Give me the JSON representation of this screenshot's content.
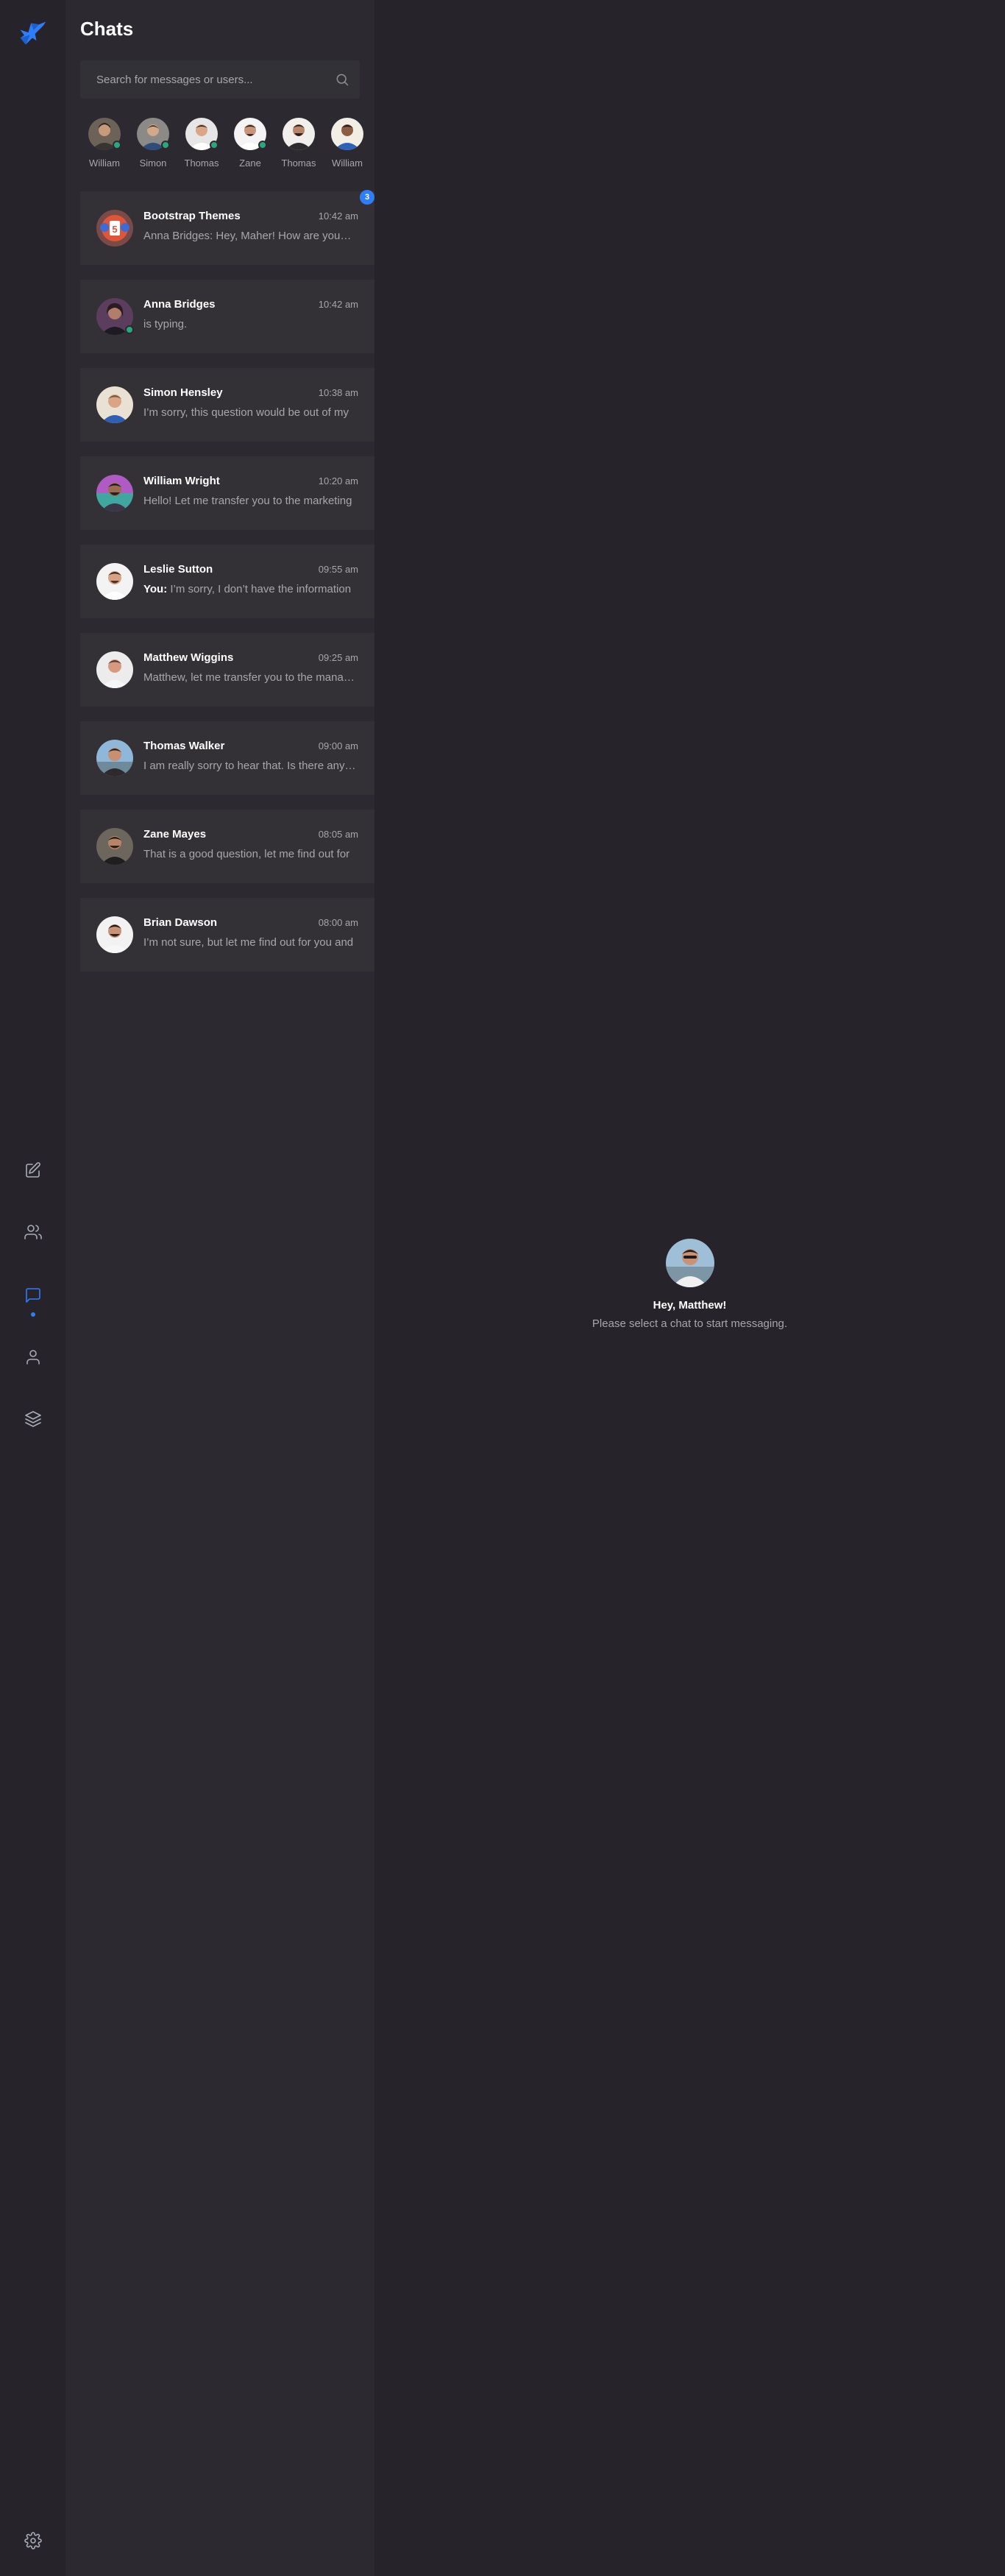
{
  "app": {
    "logo_icon": "bird-logo-icon",
    "accent_color": "#2f7ef7",
    "online_color": "#2aa77d"
  },
  "nav": {
    "items": [
      {
        "name": "edit-icon"
      },
      {
        "name": "contacts-icon"
      },
      {
        "name": "chats-icon",
        "active": true
      },
      {
        "name": "profile-icon"
      },
      {
        "name": "layers-icon"
      },
      {
        "name": "settings-icon"
      }
    ]
  },
  "panel": {
    "title": "Chats",
    "search_placeholder": "Search for messages or users..."
  },
  "stories": [
    {
      "label": "William",
      "online": true
    },
    {
      "label": "Simon",
      "online": true
    },
    {
      "label": "Thomas",
      "online": true
    },
    {
      "label": "Zane",
      "online": true
    },
    {
      "label": "Thomas",
      "online": false
    },
    {
      "label": "William",
      "online": false
    }
  ],
  "chats": [
    {
      "name": "Bootstrap Themes",
      "time": "10:42 am",
      "preview": "Anna Bridges: Hey, Maher! How are you? The",
      "badge": "3",
      "you": false
    },
    {
      "name": "Anna Bridges",
      "time": "10:42 am",
      "preview": "is typing.",
      "online": true,
      "you": false
    },
    {
      "name": "Simon Hensley",
      "time": "10:38 am",
      "preview": "I’m sorry, this question would be out of my",
      "you": false
    },
    {
      "name": "William Wright",
      "time": "10:20 am",
      "preview": "Hello! Let me transfer you to the marketing",
      "you": false
    },
    {
      "name": "Leslie Sutton",
      "time": "09:55 am",
      "preview_prefix": "You:",
      "preview": "I’m sorry, I don’t have the information",
      "you": true
    },
    {
      "name": "Matthew Wiggins",
      "time": "09:25 am",
      "preview": "Matthew, let me transfer you to the manager",
      "you": false
    },
    {
      "name": "Thomas Walker",
      "time": "09:00 am",
      "preview": "I am really sorry to hear that. Is there anything",
      "you": false
    },
    {
      "name": "Zane Mayes",
      "time": "08:05 am",
      "preview": "That is a good question, let me find out for",
      "you": false
    },
    {
      "name": "Brian Dawson",
      "time": "08:00 am",
      "preview": "I’m not sure, but let me find out for you and",
      "you": false
    }
  ],
  "welcome": {
    "greeting": "Hey, Matthew!",
    "hint": "Please select a chat to start messaging."
  }
}
